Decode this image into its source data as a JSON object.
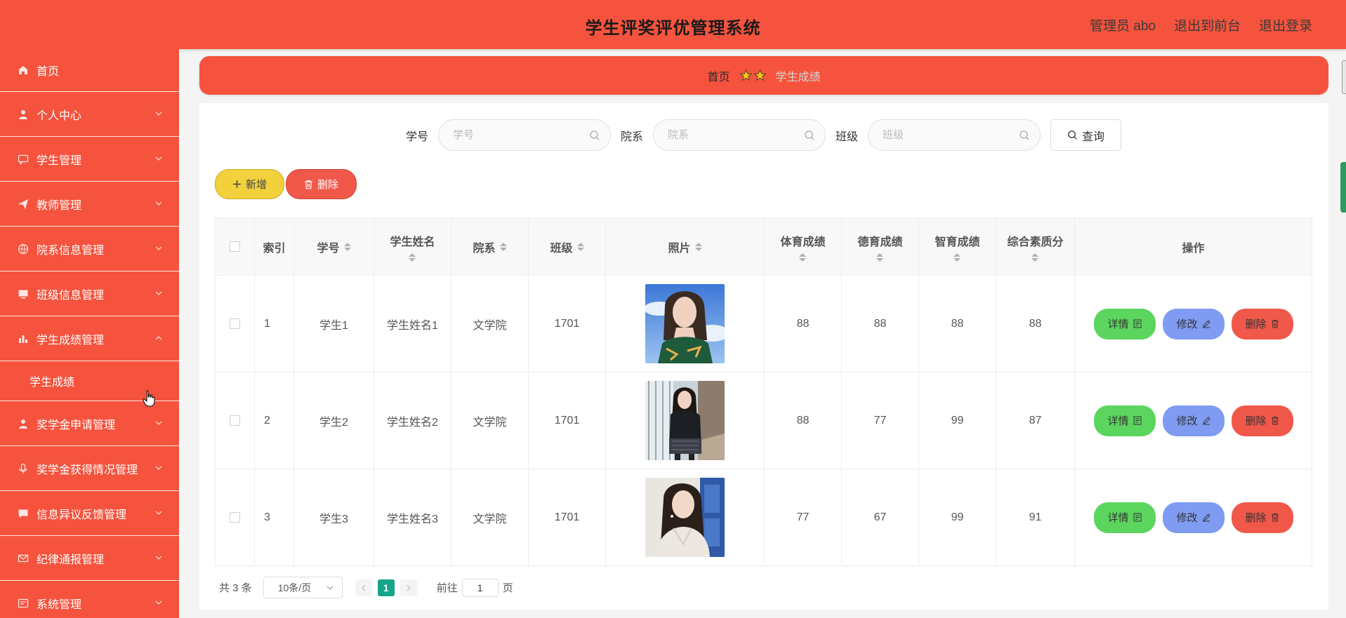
{
  "header": {
    "title": "学生评奖评优管理系统",
    "user": "管理员 abo",
    "front_link": "退出到前台",
    "logout_link": "退出登录"
  },
  "sidebar": {
    "items": [
      {
        "label": "首页",
        "icon": "home-icon"
      },
      {
        "label": "个人中心",
        "icon": "user-icon"
      },
      {
        "label": "学生管理",
        "icon": "chat-icon"
      },
      {
        "label": "教师管理",
        "icon": "send-icon"
      },
      {
        "label": "院系信息管理",
        "icon": "globe-icon"
      },
      {
        "label": "班级信息管理",
        "icon": "monitor-icon"
      },
      {
        "label": "学生成绩管理",
        "icon": "bar-chart-icon",
        "expanded": true
      },
      {
        "label": "奖学金申请管理",
        "icon": "user-icon"
      },
      {
        "label": "奖学金获得情况管理",
        "icon": "mic-icon"
      },
      {
        "label": "信息异议反馈管理",
        "icon": "message-icon"
      },
      {
        "label": "纪律通报管理",
        "icon": "mail-icon"
      },
      {
        "label": "系统管理",
        "icon": "settings-icon"
      }
    ],
    "sub_item": "学生成绩"
  },
  "breadcrumb": {
    "home": "首页",
    "current": "学生成绩"
  },
  "search": {
    "student_id_label": "学号",
    "student_id_placeholder": "学号",
    "department_label": "院系",
    "department_placeholder": "院系",
    "class_label": "班级",
    "class_placeholder": "班级",
    "query_button": "查询"
  },
  "actions": {
    "add": "新增",
    "delete": "删除"
  },
  "table": {
    "headers": {
      "index": "索引",
      "student_id": "学号",
      "student_name": "学生姓名",
      "department": "院系",
      "class": "班级",
      "photo": "照片",
      "pe_score": "体育成绩",
      "moral_score": "德育成绩",
      "intellect_score": "智育成绩",
      "overall_score": "综合素质分",
      "operation": "操作"
    },
    "rows": [
      {
        "index": "1",
        "student_id": "学生1",
        "student_name": "学生姓名1",
        "department": "文学院",
        "class": "1701",
        "pe_score": "88",
        "moral_score": "88",
        "intellect_score": "88",
        "overall_score": "88"
      },
      {
        "index": "2",
        "student_id": "学生2",
        "student_name": "学生姓名2",
        "department": "文学院",
        "class": "1701",
        "pe_score": "88",
        "moral_score": "77",
        "intellect_score": "99",
        "overall_score": "87"
      },
      {
        "index": "3",
        "student_id": "学生3",
        "student_name": "学生姓名3",
        "department": "文学院",
        "class": "1701",
        "pe_score": "77",
        "moral_score": "67",
        "intellect_score": "99",
        "overall_score": "91"
      }
    ],
    "row_buttons": {
      "detail": "详情",
      "edit": "修改",
      "delete": "删除"
    }
  },
  "pagination": {
    "total": "共 3 条",
    "page_size": "10条/页",
    "current_page": "1",
    "goto_prefix": "前往",
    "goto_value": "1",
    "goto_suffix": "页"
  },
  "colors": {
    "primary": "#f5533d",
    "add_button": "#f2d13c",
    "detail_button": "#5bd55e",
    "edit_button": "#7f9bf2",
    "delete_button": "#f0584a",
    "active_page": "#17a589"
  }
}
